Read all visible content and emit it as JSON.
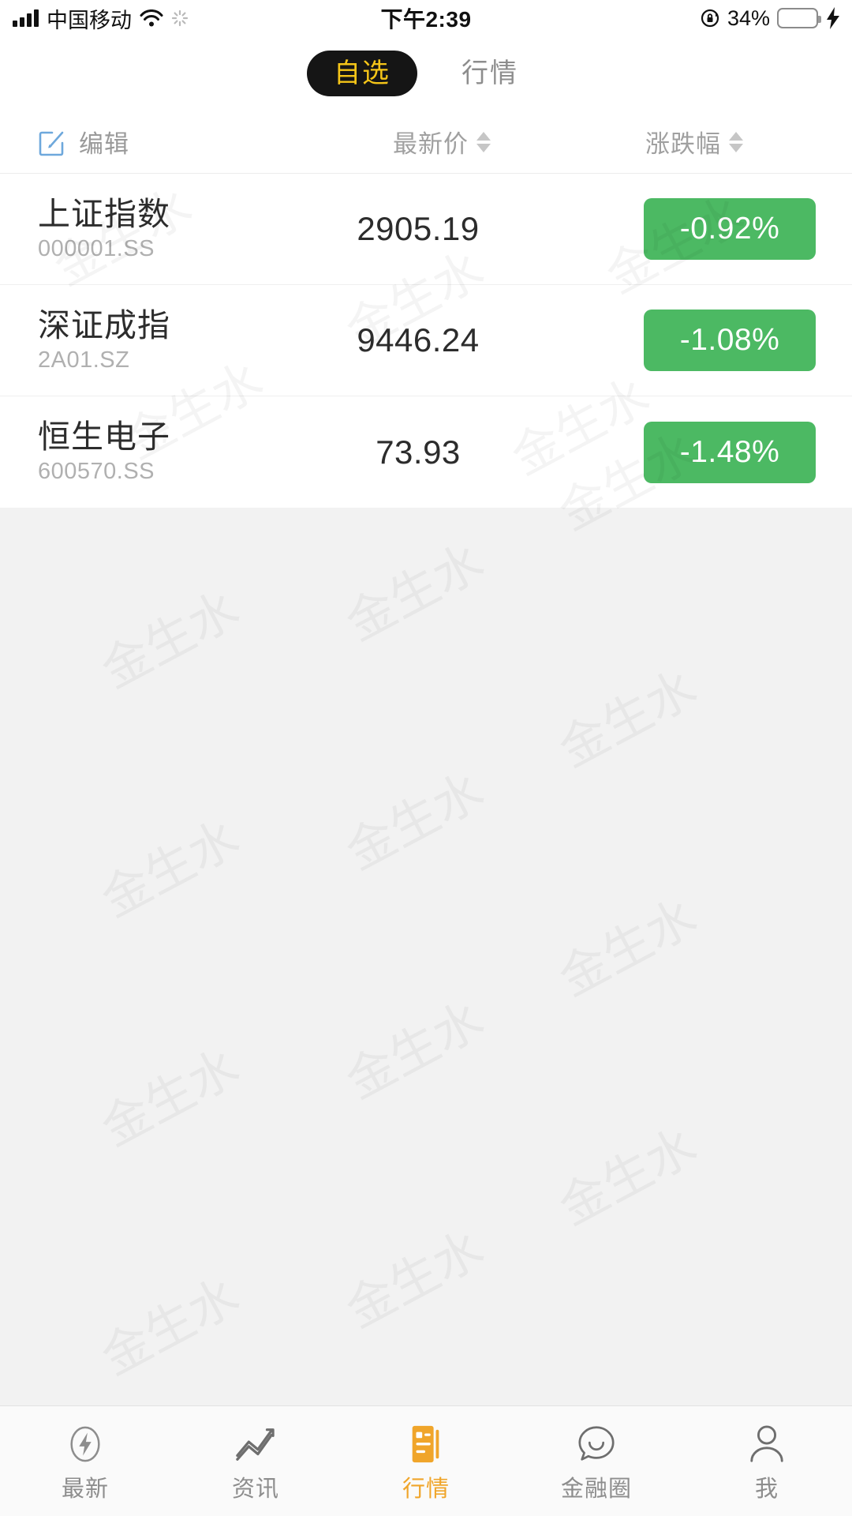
{
  "statusbar": {
    "carrier": "中国移动",
    "time": "下午2:39",
    "battery_pct": "34%",
    "battery_level": 34,
    "icons": {
      "signal": "signal-bars-icon",
      "wifi": "wifi-icon",
      "spinner": "activity-spinner-icon",
      "rotation_lock": "rotation-lock-icon",
      "battery": "battery-icon",
      "charging": "charging-bolt-icon"
    }
  },
  "topnav": {
    "tabs": [
      {
        "label": "自选",
        "active": true
      },
      {
        "label": "行情",
        "active": false
      }
    ]
  },
  "colheader": {
    "edit_label": "编辑",
    "price_label": "最新价",
    "change_label": "涨跌幅"
  },
  "watchlist": {
    "rows": [
      {
        "name": "上证指数",
        "code": "000001.SS",
        "price": "2905.19",
        "change": "-0.92%",
        "direction": "down"
      },
      {
        "name": "深证成指",
        "code": "2A01.SZ",
        "price": "9446.24",
        "change": "-1.08%",
        "direction": "down"
      },
      {
        "name": "恒生电子",
        "code": "600570.SS",
        "price": "73.93",
        "change": "-1.48%",
        "direction": "down"
      }
    ]
  },
  "watermark": {
    "text": "金生水"
  },
  "tabbar": {
    "items": [
      {
        "label": "最新",
        "icon": "lightning-circle-icon",
        "active": false
      },
      {
        "label": "资讯",
        "icon": "line-chart-icon",
        "active": false
      },
      {
        "label": "行情",
        "icon": "quote-document-icon",
        "active": true
      },
      {
        "label": "金融圈",
        "icon": "chat-bubble-icon",
        "active": false
      },
      {
        "label": "我",
        "icon": "person-icon",
        "active": false
      }
    ]
  },
  "colors": {
    "accent": "#f0a52a",
    "pill_text": "#f5c518",
    "pill_bg": "#151515",
    "down_badge": "#4cb963",
    "page_bg": "#f2f2f2"
  }
}
